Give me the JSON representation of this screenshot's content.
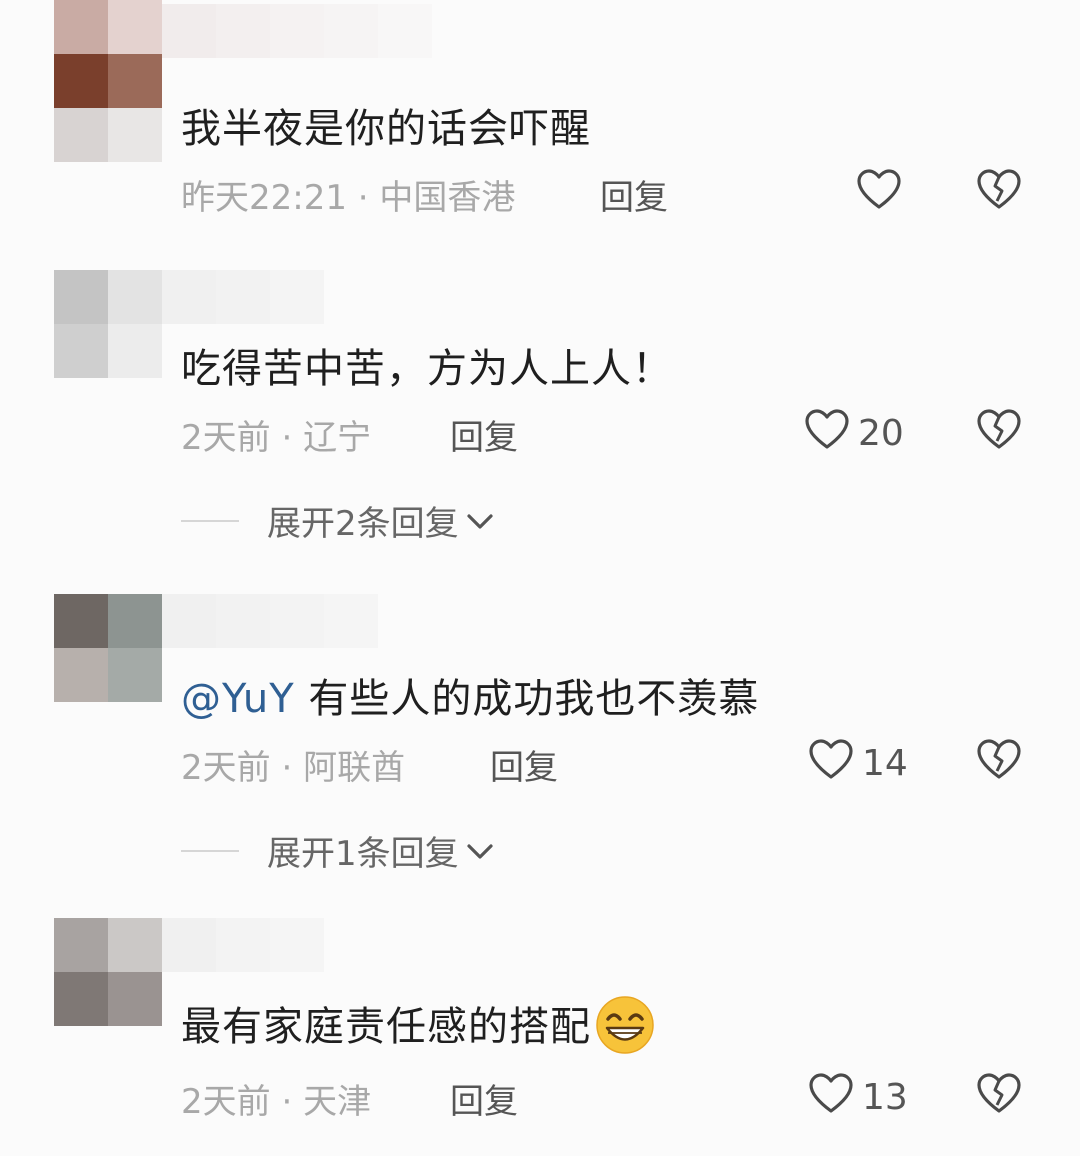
{
  "comments": [
    {
      "text": "我半夜是你的话会吓醒",
      "time": "昨天22:21",
      "location": "中国香港",
      "reply_label": "回复",
      "likes": ""
    },
    {
      "text": "吃得苦中苦，方为人上人！",
      "time": "2天前",
      "location": "辽宁",
      "reply_label": "回复",
      "likes": "20",
      "expand_label": "展开2条回复"
    },
    {
      "mention": "@YuY",
      "text": "有些人的成功我也不羡慕",
      "time": "2天前",
      "location": "阿联酋",
      "reply_label": "回复",
      "likes": "14",
      "expand_label": "展开1条回复"
    },
    {
      "text": "最有家庭责任感的搭配",
      "time": "2天前",
      "location": "天津",
      "reply_label": "回复",
      "likes": "13"
    }
  ],
  "meta_separator": " · ",
  "icons": {
    "like": "heart-outline-icon",
    "dislike": "broken-heart-icon",
    "expand": "chevron-down-icon",
    "emoji": "grinning-face-emoji"
  },
  "colors": {
    "text": "#1f1f1f",
    "meta": "#a8a8a8",
    "mention": "#2f5f93",
    "icon": "#4a4a4a"
  }
}
